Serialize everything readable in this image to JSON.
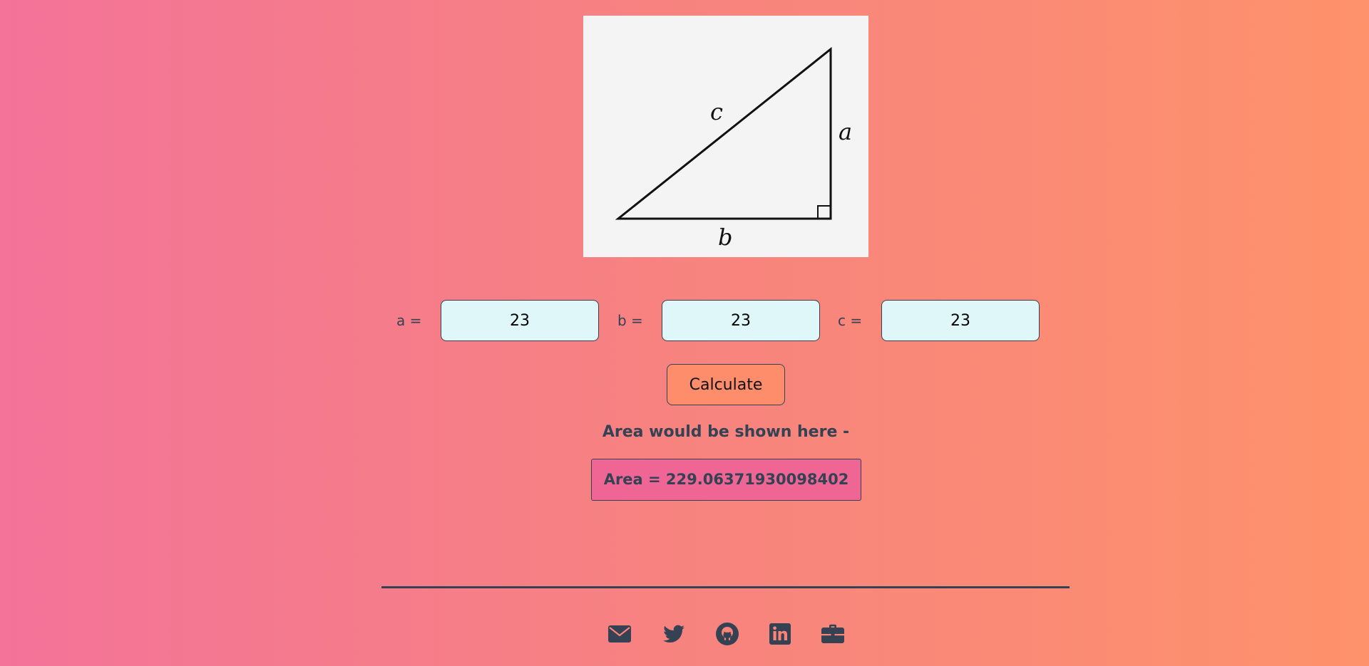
{
  "figure": {
    "labels": {
      "a": "a",
      "b": "b",
      "c": "c"
    }
  },
  "inputs": [
    {
      "label": "a =",
      "value": "23"
    },
    {
      "label": "b =",
      "value": "23"
    },
    {
      "label": "c =",
      "value": "23"
    }
  ],
  "calculate_label": "Calculate",
  "area_heading": "Area would be shown here -",
  "area_result": "Area = 229.06371930098402",
  "socials": [
    {
      "icon": "envelope-icon"
    },
    {
      "icon": "twitter-icon"
    },
    {
      "icon": "github-icon"
    },
    {
      "icon": "linkedin-icon"
    },
    {
      "icon": "briefcase-icon"
    }
  ],
  "colors": {
    "gradient_start": "#f37399",
    "gradient_end": "#fe926b",
    "text": "#344254",
    "input_bg": "#dff7f8",
    "button_bg": "#fe8d6b",
    "result_bg": "#ef6695"
  }
}
